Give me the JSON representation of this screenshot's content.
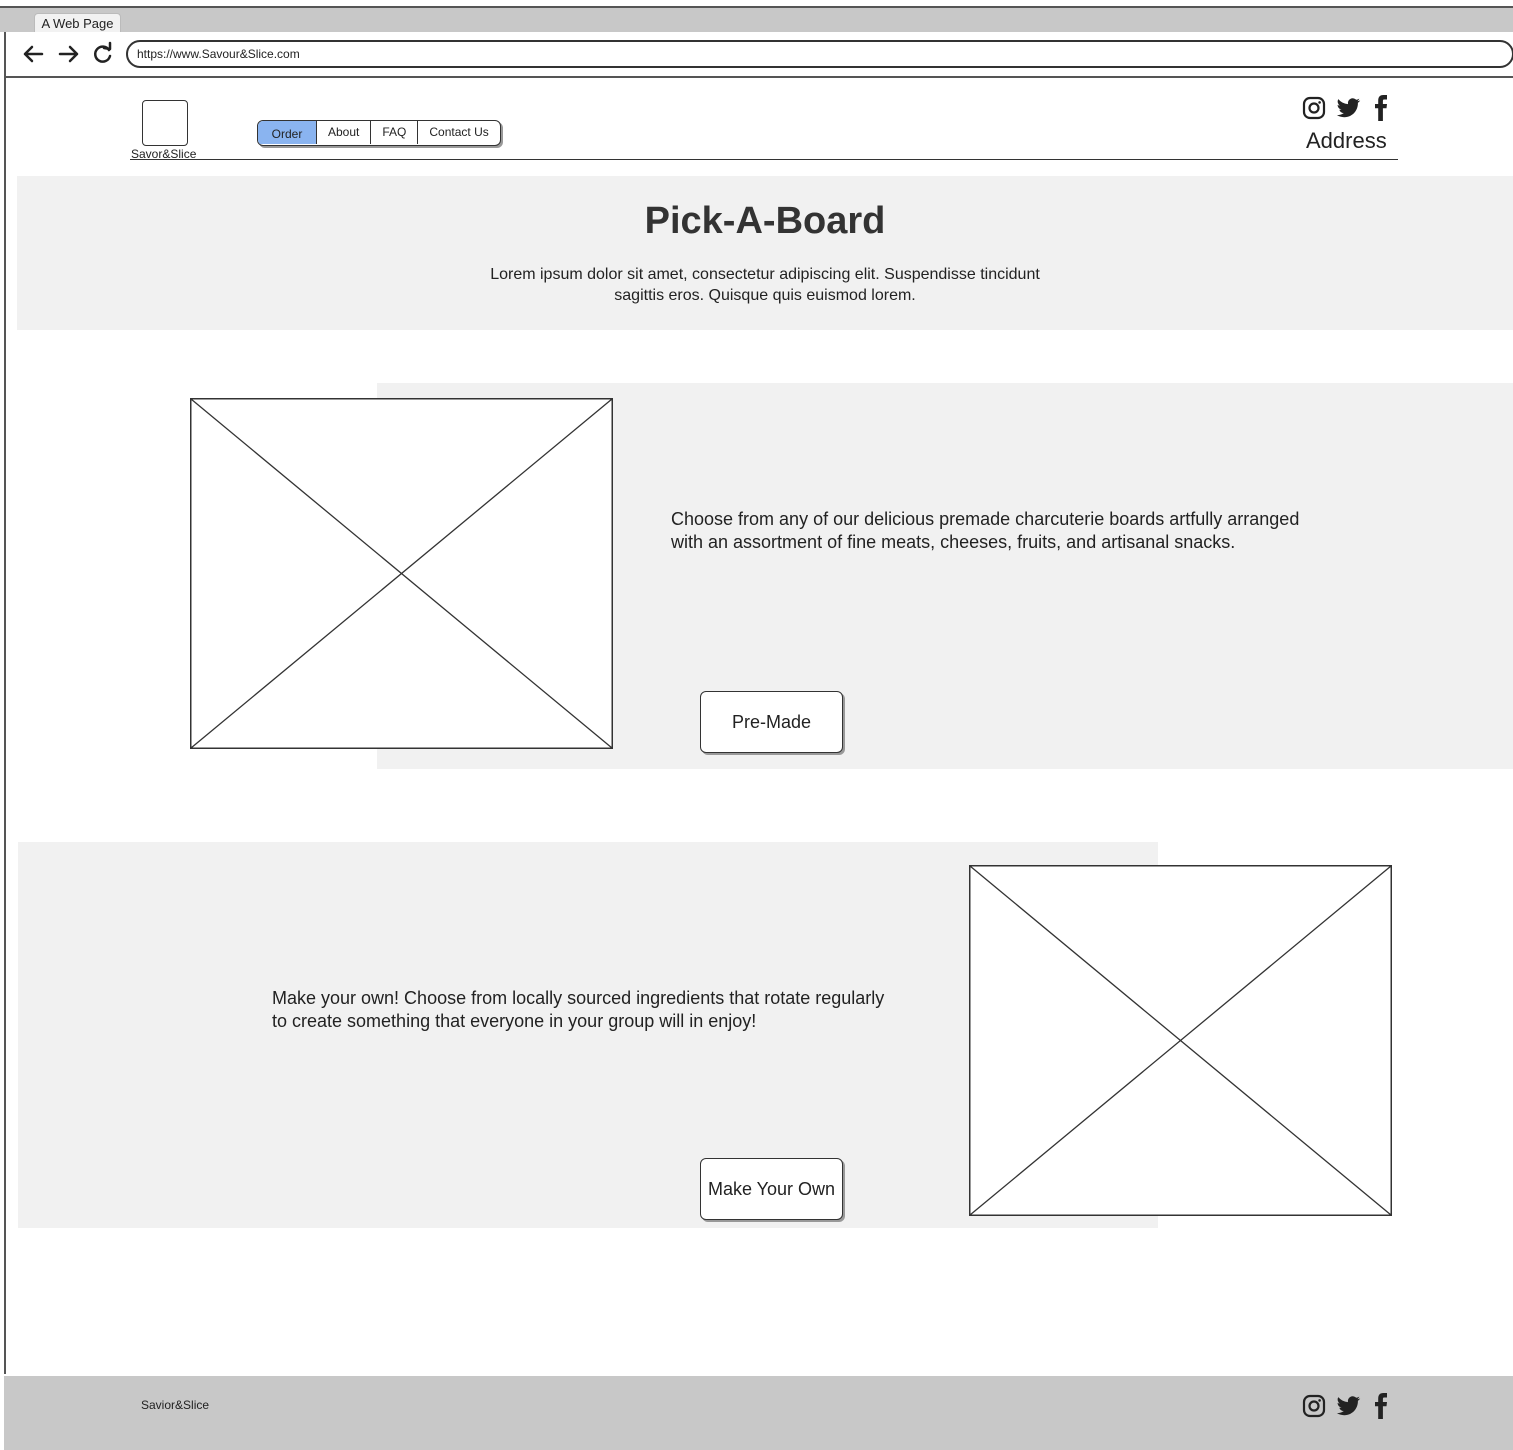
{
  "browser": {
    "tab_title": "A Web Page",
    "url": "https://www.Savour&Slice.com",
    "icons": [
      "back-arrow-icon",
      "forward-arrow-icon",
      "reload-icon"
    ]
  },
  "header": {
    "logo_text": "Savor&Slice",
    "nav": [
      {
        "label": "Order",
        "active": true
      },
      {
        "label": "About"
      },
      {
        "label": "FAQ"
      },
      {
        "label": "Contact Us"
      }
    ],
    "address": "Address",
    "social_icons": [
      "instagram-icon",
      "twitter-icon",
      "facebook-icon"
    ]
  },
  "hero": {
    "title": "Pick-A-Board",
    "text": "Lorem ipsum dolor sit amet, consectetur adipiscing elit. Suspendisse tincidunt sagittis eros. Quisque quis euismod lorem."
  },
  "sections": [
    {
      "text": "Choose from any of our delicious premade charcuterie boards artfully arranged with an assortment of fine meats, cheeses, fruits, and artisanal snacks.",
      "button": "Pre-Made"
    },
    {
      "text": "Make your own! Choose from locally sourced ingredients that rotate regularly to create something that everyone in your group will in enjoy!",
      "button": "Make Your Own"
    }
  ],
  "footer": {
    "name": "Savior&Slice",
    "social_icons": [
      "instagram-icon",
      "twitter-icon",
      "facebook-icon"
    ]
  },
  "colors": {
    "active_nav": "#8ab4f0",
    "band": "#f1f1f1",
    "chrome": "#c8c8c8"
  }
}
